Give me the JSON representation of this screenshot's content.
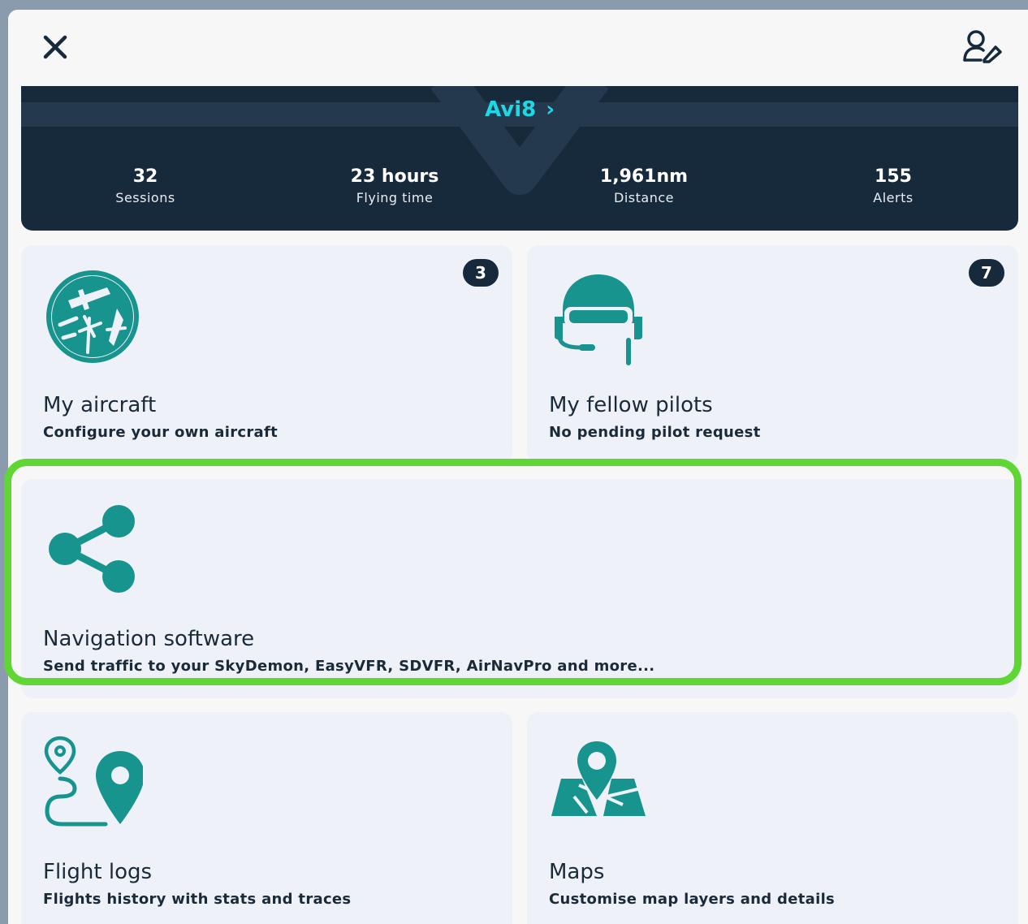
{
  "header": {
    "close_icon": "close-icon",
    "edit_profile_icon": "edit-profile-icon"
  },
  "profile": {
    "name": "Avi8",
    "link_arrow": "›",
    "stats": [
      {
        "value": "32",
        "label": "Sessions"
      },
      {
        "value": "23 hours",
        "label": "Flying time"
      },
      {
        "value": "1,961nm",
        "label": "Distance"
      },
      {
        "value": "155",
        "label": "Alerts"
      }
    ]
  },
  "cards": {
    "aircraft": {
      "title": "My aircraft",
      "subtitle": "Configure your own aircraft",
      "badge": "3",
      "icon": "aircraft-icon"
    },
    "pilots": {
      "title": "My fellow pilots",
      "subtitle": "No pending pilot request",
      "badge": "7",
      "icon": "pilot-helmet-icon"
    },
    "navigation": {
      "title": "Navigation software",
      "subtitle": "Send traffic to your SkyDemon, EasyVFR, SDVFR, AirNavPro and more...",
      "icon": "share-icon",
      "highlighted": true
    },
    "flight_logs": {
      "title": "Flight logs",
      "subtitle": "Flights history with stats and traces",
      "icon": "route-icon"
    },
    "maps": {
      "title": "Maps",
      "subtitle": "Customise map layers and details",
      "icon": "map-pin-icon"
    }
  },
  "colors": {
    "accent_teal": "#17948d",
    "dark_navy": "#172a3c",
    "link_cyan": "#1fd8e6",
    "highlight_green": "#5fd633",
    "card_bg": "#eef1f8"
  }
}
